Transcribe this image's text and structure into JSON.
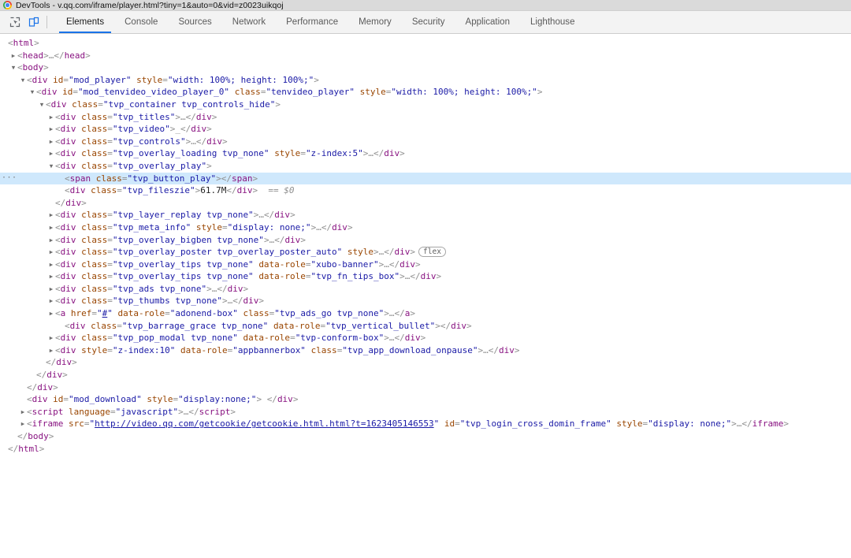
{
  "titlebar": {
    "icon": "chrome-logo-icon",
    "text": "DevTools - v.qq.com/iframe/player.html?tiny=1&auto=0&vid=z0023uikqoj"
  },
  "toolbar": {
    "inspect_icon": "inspect-element-icon",
    "device_icon": "device-toolbar-icon",
    "tabs": [
      {
        "label": "Elements",
        "active": true
      },
      {
        "label": "Console",
        "active": false
      },
      {
        "label": "Sources",
        "active": false
      },
      {
        "label": "Network",
        "active": false
      },
      {
        "label": "Performance",
        "active": false
      },
      {
        "label": "Memory",
        "active": false
      },
      {
        "label": "Security",
        "active": false
      },
      {
        "label": "Application",
        "active": false
      },
      {
        "label": "Lighthouse",
        "active": false
      }
    ]
  },
  "colors": {
    "accent": "#1a73e8",
    "selection": "#cfe8fc",
    "tag": "#881280",
    "attr_name": "#994500",
    "attr_value": "#1a1aa6",
    "punct": "#8f8f8f"
  },
  "dom_tree": {
    "selected_row_index": 11,
    "selected_reference": "== $0",
    "nodes": [
      {
        "indent": 0,
        "twisty": "",
        "html": "<span class=\"punct\">&lt;</span><span class=\"tag\">html</span><span class=\"punct\">&gt;</span>"
      },
      {
        "indent": 1,
        "twisty": "▶",
        "html": "<span class=\"punct\">&lt;</span><span class=\"tag\">head</span><span class=\"punct\">&gt;</span><span class=\"comment\">…</span><span class=\"punct\">&lt;/</span><span class=\"tag\">head</span><span class=\"punct\">&gt;</span>"
      },
      {
        "indent": 1,
        "twisty": "▼",
        "html": "<span class=\"punct\">&lt;</span><span class=\"tag\">body</span><span class=\"punct\">&gt;</span>"
      },
      {
        "indent": 2,
        "twisty": "▼",
        "html": "<span class=\"punct\">&lt;</span><span class=\"tag\">div</span> <span class=\"attr\">id</span><span class=\"punct\">=</span><span class=\"val\">\"mod_player\"</span> <span class=\"attr\">style</span><span class=\"punct\">=</span><span class=\"val\">\"width: 100%; height: 100%;\"</span><span class=\"punct\">&gt;</span>"
      },
      {
        "indent": 3,
        "twisty": "▼",
        "html": "<span class=\"punct\">&lt;</span><span class=\"tag\">div</span> <span class=\"attr\">id</span><span class=\"punct\">=</span><span class=\"val\">\"mod_tenvideo_video_player_0\"</span> <span class=\"attr\">class</span><span class=\"punct\">=</span><span class=\"val\">\"tenvideo_player\"</span> <span class=\"attr\">style</span><span class=\"punct\">=</span><span class=\"val\">\"width: 100%; height: 100%;\"</span><span class=\"punct\">&gt;</span>"
      },
      {
        "indent": 4,
        "twisty": "▼",
        "html": "<span class=\"punct\">&lt;</span><span class=\"tag\">div</span> <span class=\"attr\">class</span><span class=\"punct\">=</span><span class=\"val\">\"tvp_container tvp_controls_hide\"</span><span class=\"punct\">&gt;</span>"
      },
      {
        "indent": 5,
        "twisty": "▶",
        "html": "<span class=\"punct\">&lt;</span><span class=\"tag\">div</span> <span class=\"attr\">class</span><span class=\"punct\">=</span><span class=\"val\">\"tvp_titles\"</span><span class=\"punct\">&gt;</span><span class=\"comment\">…</span><span class=\"punct\">&lt;/</span><span class=\"tag\">div</span><span class=\"punct\">&gt;</span>"
      },
      {
        "indent": 5,
        "twisty": "▶",
        "html": "<span class=\"punct\">&lt;</span><span class=\"tag\">div</span> <span class=\"attr\">class</span><span class=\"punct\">=</span><span class=\"val\">\"tvp_video\"</span><span class=\"punct\">&gt;</span><span class=\"comment\">_</span><span class=\"punct\">&lt;/</span><span class=\"tag\">div</span><span class=\"punct\">&gt;</span>"
      },
      {
        "indent": 5,
        "twisty": "▶",
        "html": "<span class=\"punct\">&lt;</span><span class=\"tag\">div</span> <span class=\"attr\">class</span><span class=\"punct\">=</span><span class=\"val\">\"tvp_controls\"</span><span class=\"punct\">&gt;</span><span class=\"comment\">…</span><span class=\"punct\">&lt;/</span><span class=\"tag\">div</span><span class=\"punct\">&gt;</span>"
      },
      {
        "indent": 5,
        "twisty": "▶",
        "html": "<span class=\"punct\">&lt;</span><span class=\"tag\">div</span> <span class=\"attr\">class</span><span class=\"punct\">=</span><span class=\"val\">\"tvp_overlay_loading tvp_none\"</span> <span class=\"attr\">style</span><span class=\"punct\">=</span><span class=\"val\">\"z-index:5\"</span><span class=\"punct\">&gt;</span><span class=\"comment\">…</span><span class=\"punct\">&lt;/</span><span class=\"tag\">div</span><span class=\"punct\">&gt;</span>"
      },
      {
        "indent": 5,
        "twisty": "▼",
        "html": "<span class=\"punct\">&lt;</span><span class=\"tag\">div</span> <span class=\"attr\">class</span><span class=\"punct\">=</span><span class=\"val\">\"tvp_overlay_play\"</span><span class=\"punct\">&gt;</span>"
      },
      {
        "indent": 6,
        "twisty": "",
        "html": "<span class=\"punct\">&lt;</span><span class=\"tag\">span</span> <span class=\"attr\">class</span><span class=\"punct\">=</span><span class=\"val\">\"tvp_button_play\"</span><span class=\"punct\">&gt;&lt;/</span><span class=\"tag\">span</span><span class=\"punct\">&gt;</span>"
      },
      {
        "indent": 6,
        "twisty": "",
        "html": "<span class=\"punct\">&lt;</span><span class=\"tag\">div</span> <span class=\"attr\">class</span><span class=\"punct\">=</span><span class=\"val\">\"tvp_fileszie\"</span><span class=\"punct\">&gt;</span><span class=\"text\">61.7M</span><span class=\"punct\">&lt;/</span><span class=\"tag\">div</span><span class=\"punct\">&gt;</span>  <span class=\"ref\">== $0</span>"
      },
      {
        "indent": 5,
        "twisty": "",
        "html": "<span class=\"punct\">&lt;/</span><span class=\"tag\">div</span><span class=\"punct\">&gt;</span>"
      },
      {
        "indent": 5,
        "twisty": "▶",
        "html": "<span class=\"punct\">&lt;</span><span class=\"tag\">div</span> <span class=\"attr\">class</span><span class=\"punct\">=</span><span class=\"val\">\"tvp_layer_replay tvp_none\"</span><span class=\"punct\">&gt;</span><span class=\"comment\">…</span><span class=\"punct\">&lt;/</span><span class=\"tag\">div</span><span class=\"punct\">&gt;</span>"
      },
      {
        "indent": 5,
        "twisty": "▶",
        "html": "<span class=\"punct\">&lt;</span><span class=\"tag\">div</span> <span class=\"attr\">class</span><span class=\"punct\">=</span><span class=\"val\">\"tvp_meta_info\"</span> <span class=\"attr\">style</span><span class=\"punct\">=</span><span class=\"val\">\"display: none;\"</span><span class=\"punct\">&gt;</span><span class=\"comment\">…</span><span class=\"punct\">&lt;/</span><span class=\"tag\">div</span><span class=\"punct\">&gt;</span>"
      },
      {
        "indent": 5,
        "twisty": "▶",
        "html": "<span class=\"punct\">&lt;</span><span class=\"tag\">div</span> <span class=\"attr\">class</span><span class=\"punct\">=</span><span class=\"val\">\"tvp_overlay_bigben tvp_none\"</span><span class=\"punct\">&gt;</span><span class=\"comment\">…</span><span class=\"punct\">&lt;/</span><span class=\"tag\">div</span><span class=\"punct\">&gt;</span>"
      },
      {
        "indent": 5,
        "twisty": "▶",
        "html": "<span class=\"punct\">&lt;</span><span class=\"tag\">div</span> <span class=\"attr\">class</span><span class=\"punct\">=</span><span class=\"val\">\"tvp_overlay_poster tvp_overlay_poster_auto\"</span> <span class=\"attr\">style</span><span class=\"punct\">&gt;</span><span class=\"comment\">…</span><span class=\"punct\">&lt;/</span><span class=\"tag\">div</span><span class=\"punct\">&gt;</span><span class=\"badge\">flex</span>"
      },
      {
        "indent": 5,
        "twisty": "▶",
        "html": "<span class=\"punct\">&lt;</span><span class=\"tag\">div</span> <span class=\"attr\">class</span><span class=\"punct\">=</span><span class=\"val\">\"tvp_overlay_tips tvp_none\"</span> <span class=\"attr\">data-role</span><span class=\"punct\">=</span><span class=\"val\">\"xubo-banner\"</span><span class=\"punct\">&gt;</span><span class=\"comment\">…</span><span class=\"punct\">&lt;/</span><span class=\"tag\">div</span><span class=\"punct\">&gt;</span>"
      },
      {
        "indent": 5,
        "twisty": "▶",
        "html": "<span class=\"punct\">&lt;</span><span class=\"tag\">div</span> <span class=\"attr\">class</span><span class=\"punct\">=</span><span class=\"val\">\"tvp_overlay_tips tvp_none\"</span> <span class=\"attr\">data-role</span><span class=\"punct\">=</span><span class=\"val\">\"tvp_fn_tips_box\"</span><span class=\"punct\">&gt;</span><span class=\"comment\">…</span><span class=\"punct\">&lt;/</span><span class=\"tag\">div</span><span class=\"punct\">&gt;</span>"
      },
      {
        "indent": 5,
        "twisty": "▶",
        "html": "<span class=\"punct\">&lt;</span><span class=\"tag\">div</span> <span class=\"attr\">class</span><span class=\"punct\">=</span><span class=\"val\">\"tvp_ads tvp_none\"</span><span class=\"punct\">&gt;</span><span class=\"comment\">…</span><span class=\"punct\">&lt;/</span><span class=\"tag\">div</span><span class=\"punct\">&gt;</span>"
      },
      {
        "indent": 5,
        "twisty": "▶",
        "html": "<span class=\"punct\">&lt;</span><span class=\"tag\">div</span> <span class=\"attr\">class</span><span class=\"punct\">=</span><span class=\"val\">\"tvp_thumbs tvp_none\"</span><span class=\"punct\">&gt;</span><span class=\"comment\">…</span><span class=\"punct\">&lt;/</span><span class=\"tag\">div</span><span class=\"punct\">&gt;</span>"
      },
      {
        "indent": 5,
        "twisty": "▶",
        "html": "<span class=\"punct\">&lt;</span><span class=\"tag\">a</span> <span class=\"attr\">href</span><span class=\"punct\">=</span><span class=\"val\">\"</span><span class=\"link\">#</span><span class=\"val\">\"</span> <span class=\"attr\">data-role</span><span class=\"punct\">=</span><span class=\"val\">\"adonend-box\"</span> <span class=\"attr\">class</span><span class=\"punct\">=</span><span class=\"val\">\"tvp_ads_go tvp_none\"</span><span class=\"punct\">&gt;</span><span class=\"comment\">…</span><span class=\"punct\">&lt;/</span><span class=\"tag\">a</span><span class=\"punct\">&gt;</span>"
      },
      {
        "indent": 6,
        "twisty": "",
        "html": "<span class=\"punct\">&lt;</span><span class=\"tag\">div</span> <span class=\"attr\">class</span><span class=\"punct\">=</span><span class=\"val\">\"tvp_barrage_grace tvp_none\"</span> <span class=\"attr\">data-role</span><span class=\"punct\">=</span><span class=\"val\">\"tvp_vertical_bullet\"</span><span class=\"punct\">&gt;&lt;/</span><span class=\"tag\">div</span><span class=\"punct\">&gt;</span>"
      },
      {
        "indent": 5,
        "twisty": "▶",
        "html": "<span class=\"punct\">&lt;</span><span class=\"tag\">div</span> <span class=\"attr\">class</span><span class=\"punct\">=</span><span class=\"val\">\"tvp_pop_modal tvp_none\"</span> <span class=\"attr\">data-role</span><span class=\"punct\">=</span><span class=\"val\">\"tvp-conform-box\"</span><span class=\"punct\">&gt;</span><span class=\"comment\">…</span><span class=\"punct\">&lt;/</span><span class=\"tag\">div</span><span class=\"punct\">&gt;</span>"
      },
      {
        "indent": 5,
        "twisty": "▶",
        "html": "<span class=\"punct\">&lt;</span><span class=\"tag\">div</span> <span class=\"attr\">style</span><span class=\"punct\">=</span><span class=\"val\">\"z-index:10\"</span> <span class=\"attr\">data-role</span><span class=\"punct\">=</span><span class=\"val\">\"appbannerbox\"</span> <span class=\"attr\">class</span><span class=\"punct\">=</span><span class=\"val\">\"tvp_app_download_onpause\"</span><span class=\"punct\">&gt;</span><span class=\"comment\">…</span><span class=\"punct\">&lt;/</span><span class=\"tag\">div</span><span class=\"punct\">&gt;</span>"
      },
      {
        "indent": 4,
        "twisty": "",
        "html": "<span class=\"punct\">&lt;/</span><span class=\"tag\">div</span><span class=\"punct\">&gt;</span>"
      },
      {
        "indent": 3,
        "twisty": "",
        "html": "<span class=\"punct\">&lt;/</span><span class=\"tag\">div</span><span class=\"punct\">&gt;</span>"
      },
      {
        "indent": 2,
        "twisty": "",
        "html": "<span class=\"punct\">&lt;/</span><span class=\"tag\">div</span><span class=\"punct\">&gt;</span>"
      },
      {
        "indent": 2,
        "twisty": "",
        "html": "<span class=\"punct\">&lt;</span><span class=\"tag\">div</span> <span class=\"attr\">id</span><span class=\"punct\">=</span><span class=\"val\">\"mod_download\"</span> <span class=\"attr\">style</span><span class=\"punct\">=</span><span class=\"val\">\"display:none;\"</span><span class=\"punct\">&gt;</span> <span class=\"punct\">&lt;/</span><span class=\"tag\">div</span><span class=\"punct\">&gt;</span>"
      },
      {
        "indent": 2,
        "twisty": "▶",
        "html": "<span class=\"punct\">&lt;</span><span class=\"tag\">script</span> <span class=\"attr\">language</span><span class=\"punct\">=</span><span class=\"val\">\"javascript\"</span><span class=\"punct\">&gt;</span><span class=\"comment\">…</span><span class=\"punct\">&lt;/</span><span class=\"tag\">script</span><span class=\"punct\">&gt;</span>"
      },
      {
        "indent": 2,
        "twisty": "▶",
        "html": "<span class=\"punct\">&lt;</span><span class=\"tag\">iframe</span> <span class=\"attr\">src</span><span class=\"punct\">=</span><span class=\"val\">\"</span><span class=\"link\">http://video.qq.com/getcookie/getcookie.html.html?t=1623405146553</span><span class=\"val\">\"</span> <span class=\"attr\">id</span><span class=\"punct\">=</span><span class=\"val\">\"tvp_login_cross_domin_frame\"</span> <span class=\"attr\">style</span><span class=\"punct\">=</span><span class=\"val\">\"display: none;\"</span><span class=\"punct\">&gt;</span><span class=\"comment\">…</span><span class=\"punct\">&lt;/</span><span class=\"tag\">iframe</span><span class=\"punct\">&gt;</span>"
      },
      {
        "indent": 1,
        "twisty": "",
        "html": "<span class=\"punct\">&lt;/</span><span class=\"tag\">body</span><span class=\"punct\">&gt;</span>"
      },
      {
        "indent": 0,
        "twisty": "",
        "html": "<span class=\"punct\">&lt;/</span><span class=\"tag\">html</span><span class=\"punct\">&gt;</span>"
      }
    ]
  }
}
